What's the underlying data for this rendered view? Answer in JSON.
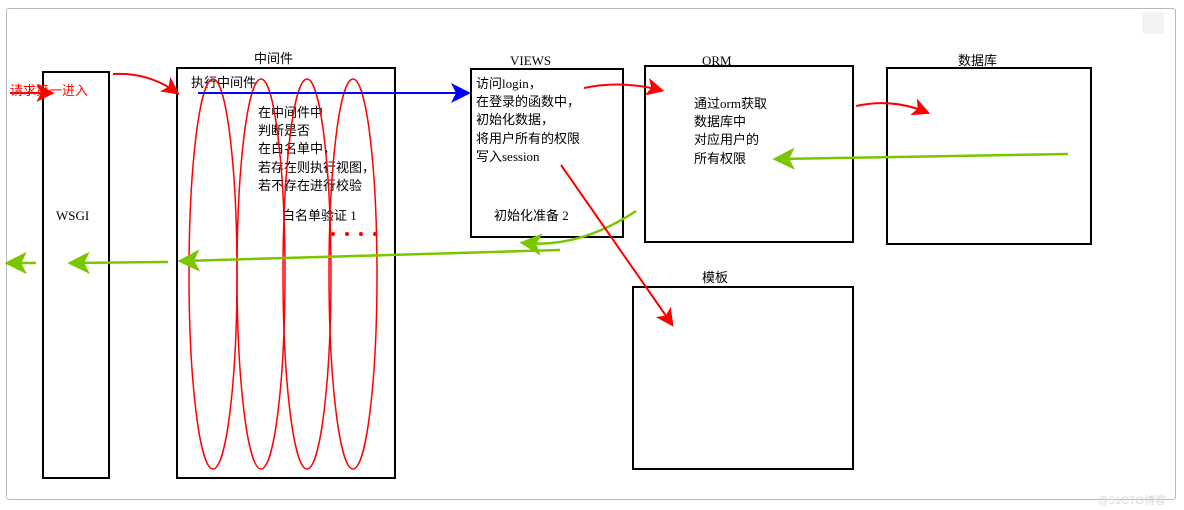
{
  "entry": {
    "text": "请求第一进入",
    "color": "#ff0000"
  },
  "wsgi": {
    "label": "WSGI"
  },
  "middleware": {
    "title": "中间件",
    "exec": "执行中间件",
    "desc": "在中间件中\n判断是否\n在白名单中，\n若存在则执行视图，\n若不存在进行校验",
    "whitelist": "白名单验证 1"
  },
  "views": {
    "title": "VIEWS",
    "desc": "访问login，\n在登录的函数中，\n初始化数据，\n将用户所有的权限\n写入session",
    "init": "初始化准备 2"
  },
  "orm": {
    "title": "ORM",
    "desc": "通过orm获取\n数据库中\n对应用户的\n所有权限"
  },
  "db": {
    "title": "数据库"
  },
  "template": {
    "title": "模板"
  },
  "watermark": "@51CTO博客"
}
